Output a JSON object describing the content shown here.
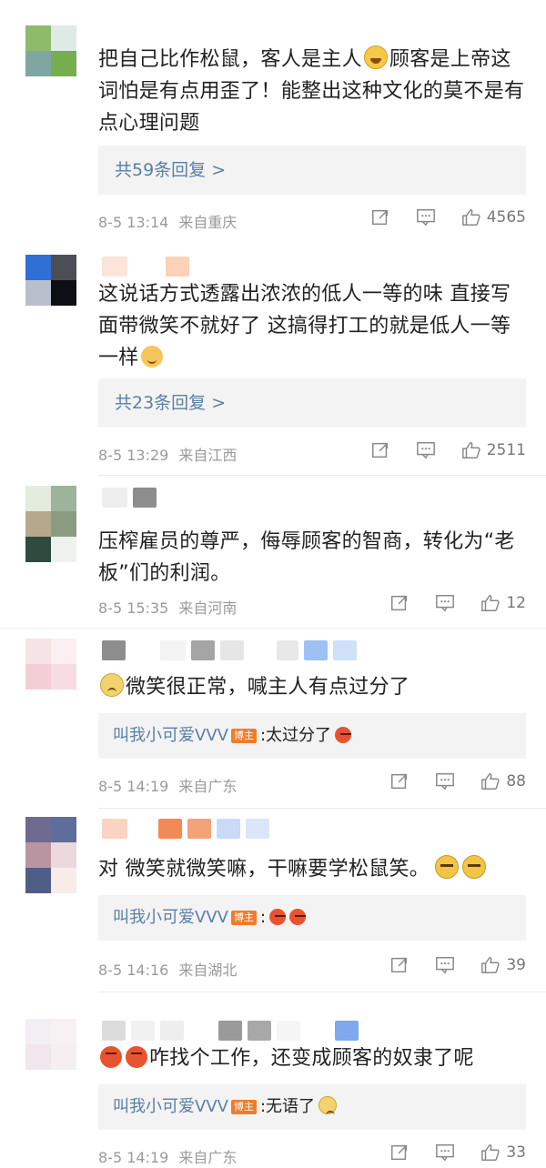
{
  "comments": [
    {
      "text_parts": [
        "把自己比作松鼠，客人是主人",
        "顾客是上帝这词怕是有点用歪了！能整出这种文化的莫不是有点心理问题"
      ],
      "replies_more": "共59条回复 >",
      "time": "8-5 13:14",
      "location": "来自重庆",
      "likes": "4565"
    },
    {
      "text_parts": [
        "这说话方式透露出浓浓的低人一等的味 直接写面带微笑不就好了 这搞得打工的就是低人一等一样"
      ],
      "replies_more": "共23条回复 >",
      "time": "8-5 13:29",
      "location": "来自江西",
      "likes": "2511"
    },
    {
      "text_parts": [
        "压榨雇员的尊严，侮辱顾客的智商，转化为“老板”们的利润。"
      ],
      "time": "8-5 15:35",
      "location": "来自河南",
      "likes": "12"
    },
    {
      "text_parts": [
        "微笑很正常，喊主人有点过分了"
      ],
      "reply": {
        "name": "叫我小可爱VVV",
        "badge": "博主",
        "text": ":太过分了"
      },
      "time": "8-5 14:19",
      "location": "来自广东",
      "likes": "88"
    },
    {
      "text_parts": [
        "对 微笑就微笑嘛，干嘛要学松鼠笑。"
      ],
      "reply": {
        "name": "叫我小可爱VVV",
        "badge": "博主",
        "text": ":"
      },
      "time": "8-5 14:16",
      "location": "来自湖北",
      "likes": "39"
    },
    {
      "text_parts": [
        "咋找个工作，还变成顾客的奴隶了呢"
      ],
      "reply": {
        "name": "叫我小可爱VVV",
        "badge": "博主",
        "text": ":无语了"
      },
      "time": "8-5 14:19",
      "location": "来自广东",
      "likes": "33"
    }
  ],
  "icons": {
    "share": "share-icon",
    "comment": "comment-icon",
    "like": "thumbs-up-icon"
  },
  "colors": {
    "link": "#5b7fa6",
    "badge": "#f07c2a",
    "meta": "#9a9a9a"
  }
}
